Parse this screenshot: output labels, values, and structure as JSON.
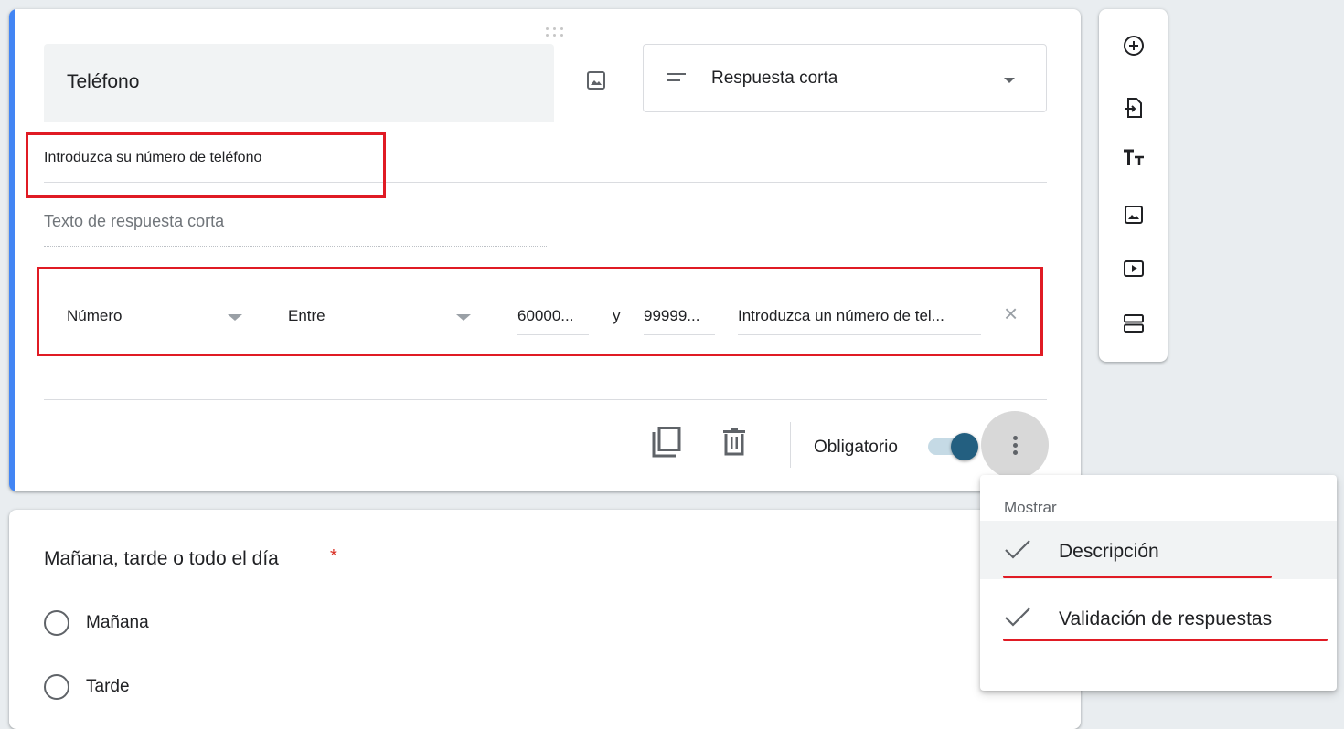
{
  "question": {
    "title": "Teléfono",
    "type_label": "Respuesta corta",
    "description": "Introduzca su número de teléfono",
    "answer_placeholder": "Texto de respuesta corta",
    "validation": {
      "kind": "Número",
      "condition": "Entre",
      "min": "60000...",
      "and_label": "y",
      "max": "99999...",
      "error_text": "Introduzca un número de tel..."
    },
    "required_label": "Obligatorio",
    "required": true
  },
  "next_question": {
    "title": "Mañana, tarde o todo el día",
    "required_mark": "*",
    "options": [
      "Mañana",
      "Tarde"
    ]
  },
  "menu": {
    "header": "Mostrar",
    "items": [
      {
        "label": "Descripción",
        "checked": true
      },
      {
        "label": "Validación de respuestas",
        "checked": true
      }
    ]
  },
  "toolbar_icons": [
    "add-question-icon",
    "import-questions-icon",
    "add-title-icon",
    "add-image-icon",
    "add-video-icon",
    "add-section-icon"
  ],
  "colors": {
    "accent": "#4285f4",
    "toggle": "#235f80",
    "highlight_red": "#e01b24",
    "required_star": "#d93025"
  }
}
